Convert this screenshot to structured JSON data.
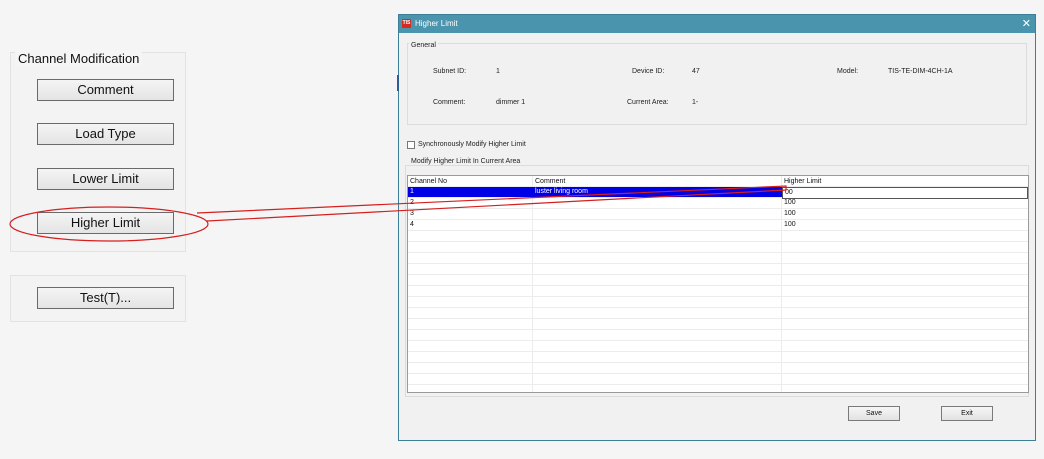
{
  "left_panel": {
    "group_title": "Channel Modification",
    "buttons": [
      "Comment",
      "Load Type",
      "Lower Limit",
      "Higher Limit"
    ],
    "test_button": "Test(T)..."
  },
  "dialog": {
    "title": "Higher Limit",
    "app_icon_text": "TIS",
    "close_glyph": "✕",
    "general": {
      "group_label": "General",
      "subnet_id_label": "Subnet ID:",
      "subnet_id_value": "1",
      "device_id_label": "Device ID:",
      "device_id_value": "47",
      "model_label": "Model:",
      "model_value": "TIS-TE-DIM-4CH-1A",
      "comment_label": "Comment:",
      "comment_value": "dimmer 1",
      "current_area_label": "Current Area:",
      "current_area_value": "1-"
    },
    "sync_checkbox_label": "Synchronously Modify Higher Limit",
    "sync_checked": false,
    "modify_group_label": "Modify Higher Limit In Current Area",
    "table": {
      "headers": [
        "Channel No",
        "Comment",
        "Higher Limit"
      ],
      "rows": [
        {
          "channel": "1",
          "comment": "luster living room",
          "limit": "00"
        },
        {
          "channel": "2",
          "comment": "",
          "limit": "100"
        },
        {
          "channel": "3",
          "comment": "",
          "limit": "100"
        },
        {
          "channel": "4",
          "comment": "",
          "limit": "100"
        }
      ]
    },
    "save_button": "Save",
    "exit_button": "Exit"
  },
  "colors": {
    "titlebar": "#4a95ad",
    "selection": "#0000e6",
    "annotation": "#d61f1f"
  }
}
